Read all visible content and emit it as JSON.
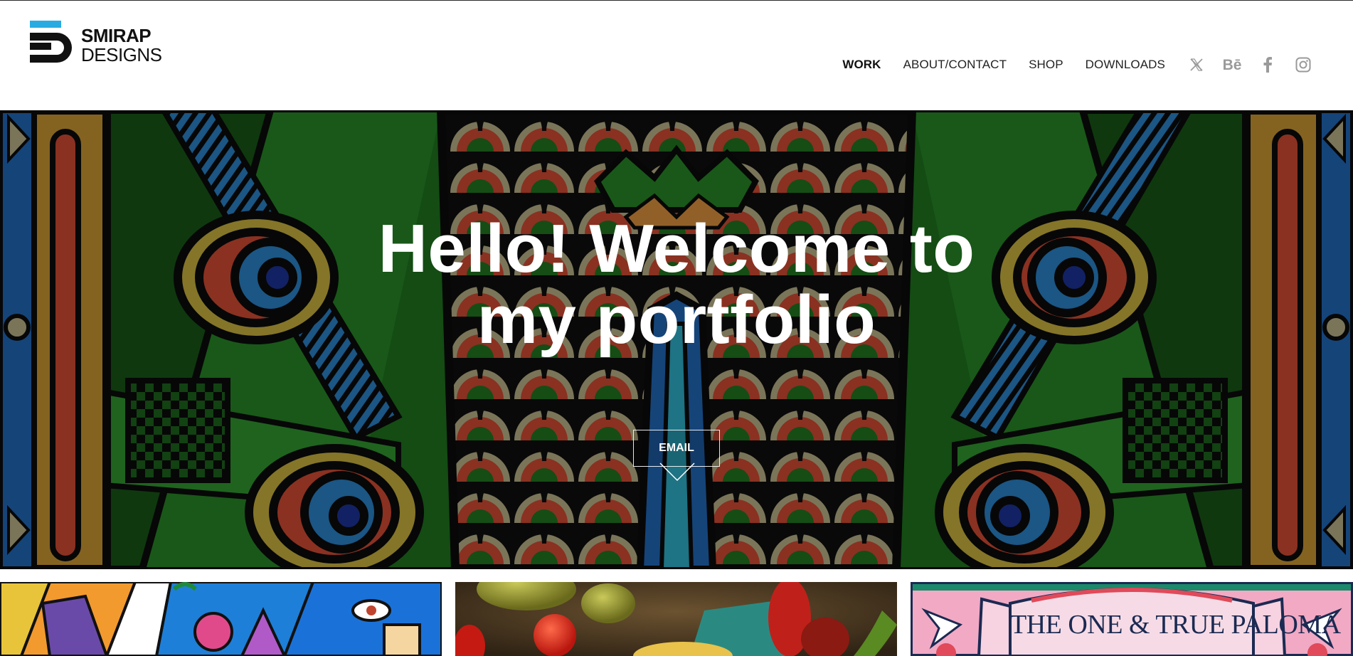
{
  "brand": {
    "name_line1": "SMIRAP",
    "name_line2": "DESIGNS",
    "accent_color": "#29abe2",
    "dark_color": "#111111"
  },
  "nav": {
    "items": [
      {
        "label": "WORK",
        "active": true
      },
      {
        "label": "ABOUT/CONTACT",
        "active": false
      },
      {
        "label": "SHOP",
        "active": false
      },
      {
        "label": "DOWNLOADS",
        "active": false
      }
    ],
    "social": [
      {
        "icon": "x-twitter-icon"
      },
      {
        "icon": "behance-icon",
        "text": "Bē"
      },
      {
        "icon": "facebook-icon"
      },
      {
        "icon": "instagram-icon"
      }
    ]
  },
  "hero": {
    "title_line1": "Hello! Welcome to",
    "title_line2": "my portfolio",
    "button_label": "EMAIL"
  },
  "projects": [
    {
      "name": "pop-art-city-illustration"
    },
    {
      "name": "vegetables-photo"
    },
    {
      "name": "paloma-poster",
      "caption": "THE ONE & TRUE PALOMA"
    }
  ]
}
